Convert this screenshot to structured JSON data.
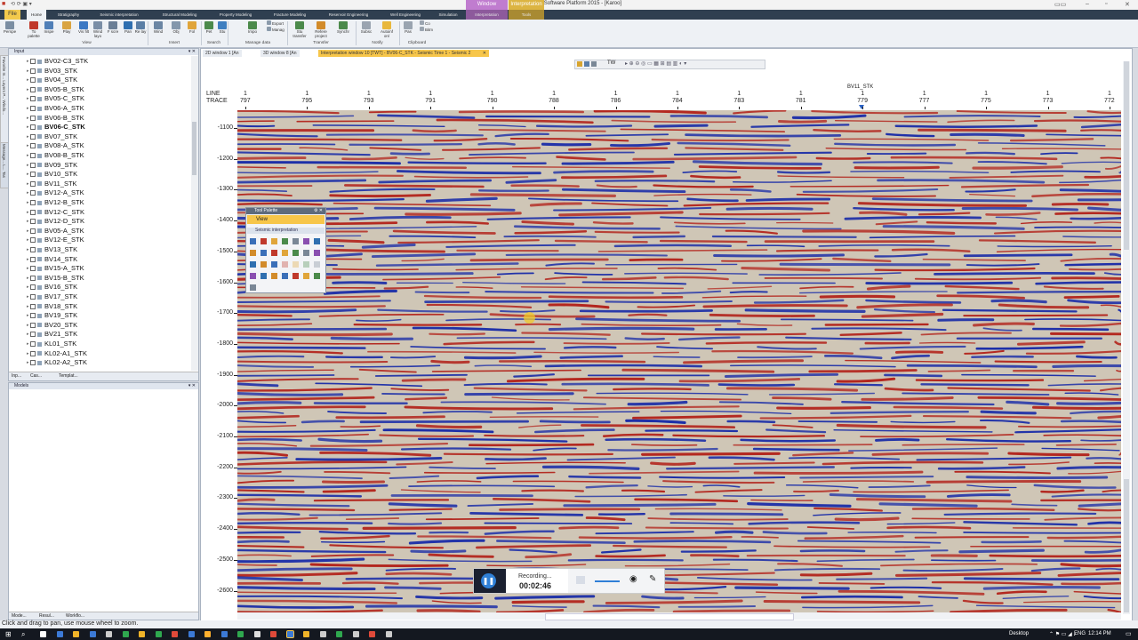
{
  "window": {
    "title": "Petrel E&P Software Platform 2015 - [Karoo]",
    "context_tab_window": "Window",
    "context_tab_interpretation": "Interpretation"
  },
  "ribbon_tabs": [
    "File",
    "Home",
    "Stratigraphy",
    "Seismic interpretation",
    "Structural Modeling",
    "Property Modeling",
    "Fracture Modeling",
    "Reservoir Engineering",
    "Well Engineering",
    "Simulation",
    "Interpretation",
    "Tools"
  ],
  "ribbon": {
    "buttons": [
      "Perspe",
      "To palette",
      "Inspe",
      "Play",
      "Vis filt",
      "Wind layo",
      "F scre",
      "Pan",
      "Re lay",
      "Wind",
      "Obj",
      "Fol",
      "Pet",
      "Stu",
      "Impo",
      "Export",
      "Manag",
      "Stu transfer",
      "Refere project",
      "Synchr",
      "Subsc",
      "Autoinf on/",
      "Pas",
      "Co",
      "Bitm"
    ],
    "groups": [
      "View",
      "Insert",
      "Search",
      "Manage data",
      "Transfer",
      "Notify",
      "Clipboard"
    ]
  },
  "input_pane": {
    "title": "Input",
    "items": [
      "BV02-C3_STK",
      "BV03_STK",
      "BV04_STK",
      "BV05-B_STK",
      "BV05-C_STK",
      "BV06-A_STK",
      "BV06-B_STK",
      "BV06-C_STK",
      "BV07_STK",
      "BV08-A_STK",
      "BV08-B_STK",
      "BV09_STK",
      "BV10_STK",
      "BV11_STK",
      "BV12-A_STK",
      "BV12-B_STK",
      "BV12-C_STK",
      "BV12-D_STK",
      "BV05-A_STK",
      "BV12-E_STK",
      "BV13_STK",
      "BV14_STK",
      "BV15-A_STK",
      "BV15-B_STK",
      "BV16_STK",
      "BV17_STK",
      "BV18_STK",
      "BV19_STK",
      "BV20_STK",
      "BV21_STK",
      "KL01_STK",
      "KL02-A1_STK",
      "KL02-A2_STK"
    ],
    "bottom_tabs": [
      "Inp...",
      "Cas...",
      "Templat..."
    ]
  },
  "models_pane": {
    "title": "Models",
    "bottom_tabs": [
      "Mode...",
      "Resul...",
      "Workflo..."
    ]
  },
  "side_tabs": [
    "Favorite",
    "In...",
    "Layers",
    "P...",
    "Windo...",
    "Message...",
    "L...",
    "Tas"
  ],
  "viewer": {
    "tabs": [
      "2D window 1 [An",
      "3D window 8 [An",
      "Interpretation window 10 [TWT] - BV06-C_STK - Seismic Time 1 - Seismic 2"
    ],
    "toolbar_domain": "TW",
    "line_label": "LINE",
    "trace_label": "TRACE",
    "line_value": "1",
    "trace_values": [
      "797",
      "795",
      "793",
      "791",
      "790",
      "788",
      "786",
      "784",
      "783",
      "781",
      "779",
      "777",
      "775",
      "773",
      "772"
    ],
    "intersect_well": "BV11_STK",
    "time_values": [
      "-1100",
      "-1200",
      "-1300",
      "-1400",
      "-1500",
      "-1600",
      "-1700",
      "-1800",
      "-1900",
      "-2000",
      "-2100",
      "-2200",
      "-2300",
      "-2400",
      "-2500",
      "-2600"
    ]
  },
  "tool_palette": {
    "title": "Tool Palette",
    "section_view": "View",
    "section_seismic": "Seismic interpretation"
  },
  "recording": {
    "status": "Recording...",
    "time": "00:02:46"
  },
  "status_bar": {
    "hint": "Click and drag to pan, use mouse wheel to zoom."
  },
  "taskbar": {
    "desktop": "Desktop",
    "lang": "ENG",
    "time": "12:14 PM"
  },
  "colors": {
    "ribbon_dark": "#2f3f50",
    "accent": "#f2c94c",
    "seismic_red": "#b3261e",
    "seismic_blue": "#1d2fa8"
  }
}
